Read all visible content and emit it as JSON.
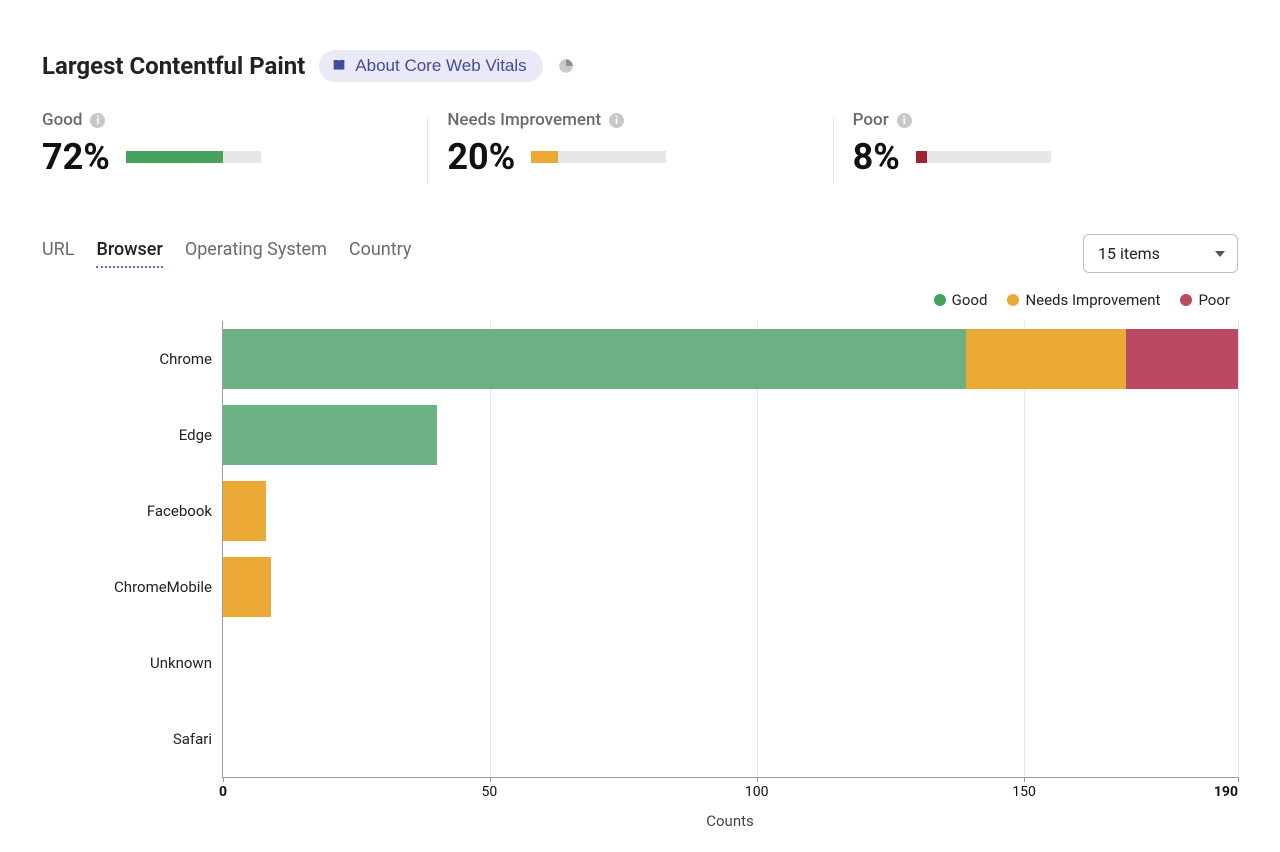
{
  "header": {
    "title": "Largest Contentful Paint",
    "pill_label": "About Core Web Vitals"
  },
  "metrics": [
    {
      "label": "Good",
      "value_text": "72%",
      "value": 72,
      "color": "#46a15d"
    },
    {
      "label": "Needs Improvement",
      "value_text": "20%",
      "value": 20,
      "color": "#eba936"
    },
    {
      "label": "Poor",
      "value_text": "8%",
      "value": 8,
      "color": "#a31f34"
    }
  ],
  "tabs": {
    "items": [
      "URL",
      "Browser",
      "Operating System",
      "Country"
    ],
    "active_index": 1
  },
  "select": {
    "label": "15 items"
  },
  "legend": [
    {
      "label": "Good",
      "color": "#46a15d"
    },
    {
      "label": "Needs Improvement",
      "color": "#eba936"
    },
    {
      "label": "Poor",
      "color": "#b94a5f"
    }
  ],
  "chart_data": {
    "type": "bar",
    "orientation": "horizontal",
    "stacked": true,
    "xlabel": "Counts",
    "ylabel": "",
    "xlim": [
      0,
      190
    ],
    "x_ticks": [
      0,
      50,
      100,
      150,
      190
    ],
    "categories": [
      "Chrome",
      "Edge",
      "Facebook",
      "ChromeMobile",
      "Unknown",
      "Safari"
    ],
    "series": [
      {
        "name": "Good",
        "color": "#6cb183",
        "values": [
          139,
          40,
          0,
          0,
          0,
          0
        ]
      },
      {
        "name": "Needs Improvement",
        "color": "#eba936",
        "values": [
          30,
          0,
          8,
          9,
          0,
          0
        ]
      },
      {
        "name": "Poor",
        "color": "#b94a5f",
        "values": [
          21,
          0,
          0,
          0,
          0,
          0
        ]
      }
    ]
  }
}
